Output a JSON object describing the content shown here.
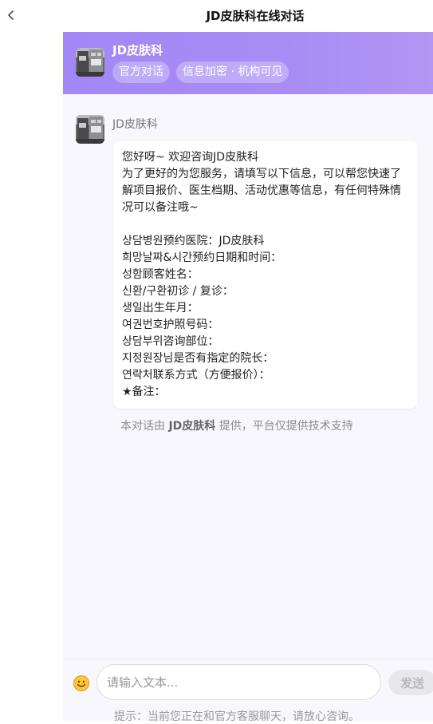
{
  "page": {
    "title": "JD皮肤科在线对话"
  },
  "header": {
    "name": "JD皮肤科",
    "tags": [
      "官方对话",
      "信息加密 · 机构可见"
    ]
  },
  "message": {
    "sender": "JD皮肤科",
    "intro_lines": [
      "您好呀~ 欢迎咨询JD皮肤科",
      "为了更好的为您服务，请填写以下信息，可以帮您快速了解项目报价、医生档期、活动优惠等信息，有任何特殊情况可以备注哦~"
    ],
    "form_lines": [
      "상담병원预约医院：JD皮肤科",
      "희망날짜&시간预约日期和时间：",
      "성함顾客姓名：",
      "신환/구환初诊 / 复诊：",
      "생일出生年月：",
      "여권번호护照号码：",
      "상담부위咨询部位：",
      "지정원장님是否有指定的院长：",
      "연락처联系方式（方便报价）：",
      "★备注："
    ]
  },
  "provider_note": {
    "prefix": "本对话由",
    "brand": "JD皮肤科",
    "suffix": "提供，平台仅提供技术支持"
  },
  "composer": {
    "placeholder": "请输入文本...",
    "send_label": "发送",
    "tip": "提示：当前您正在和官方客服聊天，请放心咨询。"
  },
  "colors": {
    "header_gradient_start": "#a288f6",
    "header_gradient_end": "#b395f3",
    "chat_background": "#f8f7fd",
    "send_disabled": "#e8e8ec"
  },
  "icons": {
    "back": "chevron-left-icon",
    "emoji": "smiley-icon"
  }
}
